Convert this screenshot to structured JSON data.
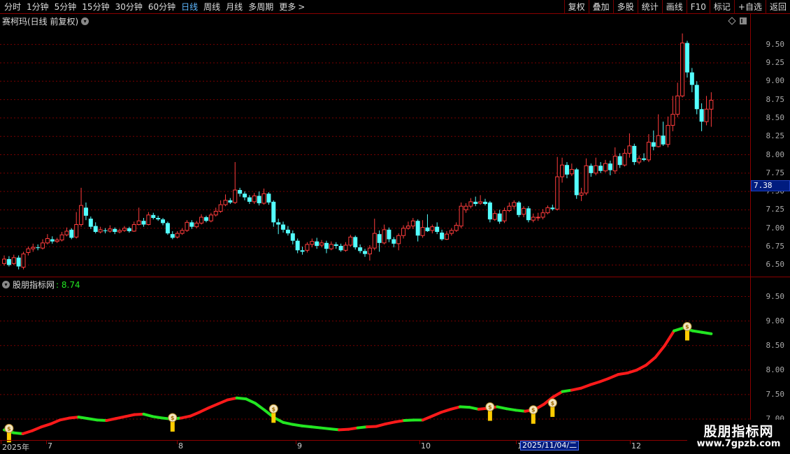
{
  "toolbar": {
    "periods": [
      "分时",
      "1分钟",
      "5分钟",
      "15分钟",
      "30分钟",
      "60分钟",
      "日线",
      "周线",
      "月线",
      "多周期",
      "更多"
    ],
    "active_period": "日线",
    "more_arrow": ">",
    "right_buttons": [
      "复权",
      "叠加",
      "多股",
      "统计",
      "画线",
      "F10",
      "标记",
      "+自选",
      "返回"
    ]
  },
  "main_panel": {
    "title": "赛柯玛(日线 前复权)",
    "dropdown_icon": "chevron-down-icon",
    "diamond_icon": "diamond-icon",
    "panel_icon": "panel-toggle-icon",
    "price_levels": [
      "9.50",
      "9.25",
      "9.00",
      "8.75",
      "8.50",
      "8.25",
      "8.00",
      "7.75",
      "7.50",
      "7.25",
      "7.00",
      "6.75",
      "6.50"
    ],
    "current_price": "7.38"
  },
  "indicator_panel": {
    "title": "股朋指标网",
    "value": ": 8.74",
    "price_levels": [
      "9.50",
      "9.00",
      "8.50",
      "8.00",
      "7.50",
      "7.00"
    ]
  },
  "date_axis": {
    "labels": [
      "2025年",
      "7",
      "8",
      "9",
      "10",
      "11",
      "12"
    ],
    "cursor_date": "2025/11/04/二"
  },
  "watermark": {
    "title": "股朋指标网",
    "url": "www.7gpzb.com"
  },
  "colors": {
    "up": "#ff3c3c",
    "down": "#54ffff",
    "line_up": "#ff1a1a",
    "line_down": "#22e622",
    "grid": "#7a0000",
    "axis": "#8b0000",
    "money_bag": "#ffcc00"
  },
  "chart_data": {
    "type": "candlestick",
    "candles": [
      [
        6.52,
        6.58,
        6.63,
        6.49
      ],
      [
        6.58,
        6.5,
        6.62,
        6.48
      ],
      [
        6.52,
        6.6,
        6.64,
        6.5
      ],
      [
        6.6,
        6.48,
        6.63,
        6.44
      ],
      [
        6.47,
        6.65,
        6.68,
        6.44
      ],
      [
        6.67,
        6.72,
        6.75,
        6.63
      ],
      [
        6.72,
        6.74,
        6.79,
        6.68
      ],
      [
        6.74,
        6.73,
        6.78,
        6.7
      ],
      [
        6.73,
        6.8,
        6.85,
        6.71
      ],
      [
        6.8,
        6.86,
        6.92,
        6.78
      ],
      [
        6.85,
        6.82,
        6.89,
        6.79
      ],
      [
        6.82,
        6.84,
        6.87,
        6.8
      ],
      [
        6.84,
        6.91,
        6.95,
        6.82
      ],
      [
        6.91,
        6.96,
        7.01,
        6.89
      ],
      [
        6.98,
        6.87,
        7.0,
        6.85
      ],
      [
        6.88,
        7.05,
        7.22,
        6.86
      ],
      [
        7.05,
        7.31,
        7.55,
        7.02
      ],
      [
        7.28,
        7.17,
        7.35,
        7.11
      ],
      [
        7.13,
        7.02,
        7.16,
        6.99
      ],
      [
        7.03,
        6.95,
        7.08,
        6.93
      ],
      [
        6.95,
        6.98,
        7.02,
        6.93
      ],
      [
        6.97,
        6.96,
        7.0,
        6.93
      ],
      [
        6.96,
        6.99,
        7.04,
        6.94
      ],
      [
        6.99,
        6.95,
        7.01,
        6.92
      ],
      [
        6.95,
        6.97,
        6.99,
        6.93
      ],
      [
        6.97,
        7.0,
        7.03,
        6.95
      ],
      [
        7.0,
        6.96,
        7.02,
        6.94
      ],
      [
        6.96,
        7.05,
        7.09,
        6.95
      ],
      [
        7.05,
        7.1,
        7.28,
        7.04
      ],
      [
        7.1,
        7.05,
        7.14,
        7.02
      ],
      [
        7.05,
        7.18,
        7.22,
        7.04
      ],
      [
        7.18,
        7.14,
        7.21,
        7.12
      ],
      [
        7.14,
        7.12,
        7.17,
        7.1
      ],
      [
        7.12,
        7.07,
        7.14,
        7.04
      ],
      [
        7.07,
        6.93,
        7.09,
        6.91
      ],
      [
        6.92,
        6.87,
        6.96,
        6.85
      ],
      [
        6.88,
        6.93,
        6.96,
        6.86
      ],
      [
        6.93,
        6.97,
        7.0,
        6.91
      ],
      [
        6.97,
        7.08,
        7.11,
        6.95
      ],
      [
        7.08,
        7.02,
        7.11,
        6.99
      ],
      [
        7.02,
        7.07,
        7.1,
        7.0
      ],
      [
        7.07,
        7.15,
        7.19,
        7.05
      ],
      [
        7.15,
        7.1,
        7.17,
        7.08
      ],
      [
        7.1,
        7.18,
        7.21,
        7.08
      ],
      [
        7.18,
        7.23,
        7.28,
        7.16
      ],
      [
        7.23,
        7.32,
        7.38,
        7.21
      ],
      [
        7.32,
        7.38,
        7.46,
        7.3
      ],
      [
        7.38,
        7.35,
        7.41,
        7.33
      ],
      [
        7.35,
        7.52,
        7.9,
        7.33
      ],
      [
        7.52,
        7.47,
        7.55,
        7.43
      ],
      [
        7.47,
        7.42,
        7.5,
        7.38
      ],
      [
        7.42,
        7.36,
        7.45,
        7.33
      ],
      [
        7.36,
        7.44,
        7.48,
        7.33
      ],
      [
        7.44,
        7.34,
        7.5,
        7.31
      ],
      [
        7.34,
        7.47,
        7.54,
        7.32
      ],
      [
        7.47,
        7.35,
        7.49,
        7.32
      ],
      [
        7.36,
        7.08,
        7.38,
        7.02
      ],
      [
        7.08,
        7.05,
        7.13,
        6.92
      ],
      [
        7.05,
        6.98,
        7.09,
        6.94
      ],
      [
        6.98,
        6.93,
        7.03,
        6.9
      ],
      [
        6.93,
        6.83,
        6.97,
        6.78
      ],
      [
        6.83,
        6.7,
        6.86,
        6.66
      ],
      [
        6.7,
        6.68,
        6.75,
        6.64
      ],
      [
        6.7,
        6.78,
        6.81,
        6.67
      ],
      [
        6.78,
        6.82,
        6.86,
        6.74
      ],
      [
        6.82,
        6.76,
        6.87,
        6.72
      ],
      [
        6.77,
        6.8,
        6.84,
        6.74
      ],
      [
        6.8,
        6.72,
        6.83,
        6.66
      ],
      [
        6.72,
        6.78,
        6.82,
        6.7
      ],
      [
        6.78,
        6.76,
        6.81,
        6.72
      ],
      [
        6.76,
        6.7,
        6.79,
        6.68
      ],
      [
        6.7,
        6.77,
        6.81,
        6.68
      ],
      [
        6.77,
        6.88,
        6.91,
        6.75
      ],
      [
        6.88,
        6.74,
        6.9,
        6.71
      ],
      [
        6.74,
        6.69,
        6.78,
        6.66
      ],
      [
        6.69,
        6.65,
        6.72,
        6.61
      ],
      [
        6.65,
        6.73,
        6.77,
        6.56
      ],
      [
        6.73,
        6.93,
        7.13,
        6.7
      ],
      [
        6.92,
        6.8,
        6.97,
        6.68
      ],
      [
        6.8,
        6.98,
        7.05,
        6.78
      ],
      [
        6.98,
        6.85,
        7.01,
        6.81
      ],
      [
        6.85,
        6.79,
        6.88,
        6.74
      ],
      [
        6.79,
        6.9,
        6.93,
        6.7
      ],
      [
        6.9,
        7.0,
        7.04,
        6.86
      ],
      [
        7.0,
        7.03,
        7.09,
        6.98
      ],
      [
        7.03,
        7.1,
        7.14,
        6.99
      ],
      [
        7.1,
        6.9,
        7.12,
        6.82
      ],
      [
        6.9,
        7.01,
        7.11,
        6.87
      ],
      [
        7.01,
        6.96,
        7.19,
        6.95
      ],
      [
        6.97,
        7.02,
        7.05,
        6.93
      ],
      [
        7.02,
        6.95,
        7.08,
        6.92
      ],
      [
        6.94,
        6.85,
        6.98,
        6.83
      ],
      [
        6.85,
        6.92,
        6.96,
        6.84
      ],
      [
        6.93,
        6.97,
        7.0,
        6.9
      ],
      [
        6.97,
        7.04,
        7.08,
        6.95
      ],
      [
        7.03,
        7.3,
        7.35,
        7.0
      ],
      [
        7.25,
        7.3,
        7.34,
        7.21
      ],
      [
        7.3,
        7.36,
        7.41,
        7.27
      ],
      [
        7.36,
        7.33,
        7.43,
        7.3
      ],
      [
        7.34,
        7.36,
        7.45,
        7.32
      ],
      [
        7.36,
        7.33,
        7.4,
        7.31
      ],
      [
        7.35,
        7.12,
        7.37,
        7.08
      ],
      [
        7.12,
        7.2,
        7.24,
        7.1
      ],
      [
        7.2,
        7.09,
        7.25,
        7.06
      ],
      [
        7.1,
        7.24,
        7.28,
        7.07
      ],
      [
        7.24,
        7.3,
        7.35,
        7.22
      ],
      [
        7.3,
        7.35,
        7.38,
        7.26
      ],
      [
        7.35,
        7.18,
        7.37,
        7.15
      ],
      [
        7.19,
        7.27,
        7.3,
        7.15
      ],
      [
        7.27,
        7.11,
        7.3,
        7.08
      ],
      [
        7.11,
        7.15,
        7.2,
        7.08
      ],
      [
        7.15,
        7.15,
        7.21,
        7.1
      ],
      [
        7.15,
        7.21,
        7.26,
        7.12
      ],
      [
        7.21,
        7.28,
        7.31,
        7.19
      ],
      [
        7.28,
        7.26,
        7.32,
        7.24
      ],
      [
        7.26,
        7.7,
        7.97,
        7.24
      ],
      [
        7.7,
        7.86,
        7.96,
        7.62
      ],
      [
        7.86,
        7.73,
        7.9,
        7.68
      ],
      [
        7.74,
        7.8,
        7.88,
        7.71
      ],
      [
        7.8,
        7.45,
        7.82,
        7.4
      ],
      [
        7.45,
        7.48,
        7.55,
        7.37
      ],
      [
        7.48,
        7.85,
        7.95,
        7.45
      ],
      [
        7.85,
        7.75,
        7.88,
        7.7
      ],
      [
        7.75,
        7.85,
        7.96,
        7.72
      ],
      [
        7.85,
        7.78,
        7.9,
        7.75
      ],
      [
        7.78,
        7.88,
        7.93,
        7.76
      ],
      [
        7.88,
        7.79,
        7.92,
        7.72
      ],
      [
        7.78,
        7.98,
        8.1,
        7.74
      ],
      [
        7.98,
        7.86,
        8.02,
        7.82
      ],
      [
        7.86,
        8.02,
        8.08,
        7.84
      ],
      [
        8.02,
        8.12,
        8.29,
        7.96
      ],
      [
        8.12,
        7.9,
        8.15,
        7.86
      ],
      [
        7.9,
        7.95,
        7.99,
        7.87
      ],
      [
        7.95,
        7.93,
        8.02,
        7.91
      ],
      [
        7.93,
        8.17,
        8.28,
        7.9
      ],
      [
        8.17,
        8.11,
        8.33,
        8.06
      ],
      [
        8.11,
        8.26,
        8.55,
        8.1
      ],
      [
        8.26,
        8.14,
        8.45,
        8.12
      ],
      [
        8.14,
        8.4,
        8.52,
        8.1
      ],
      [
        8.4,
        8.55,
        8.8,
        8.32
      ],
      [
        8.55,
        8.8,
        8.98,
        8.51
      ],
      [
        8.8,
        9.52,
        9.65,
        8.78
      ],
      [
        9.52,
        9.12,
        9.55,
        9.05
      ],
      [
        9.12,
        8.95,
        9.18,
        8.85
      ],
      [
        8.95,
        8.62,
        9.0,
        8.55
      ],
      [
        8.62,
        8.45,
        8.7,
        8.32
      ],
      [
        8.45,
        8.62,
        8.8,
        8.4
      ],
      [
        8.62,
        8.74,
        8.85,
        8.38
      ]
    ],
    "indicator_line": [
      [
        6.78,
        0
      ],
      [
        6.72,
        0
      ],
      [
        6.7,
        0
      ],
      [
        6.76,
        1
      ],
      [
        6.84,
        1
      ],
      [
        6.9,
        1
      ],
      [
        6.98,
        1
      ],
      [
        7.02,
        1
      ],
      [
        7.04,
        1
      ],
      [
        7.01,
        0
      ],
      [
        6.98,
        0
      ],
      [
        6.97,
        0
      ],
      [
        7.01,
        1
      ],
      [
        7.05,
        1
      ],
      [
        7.09,
        1
      ],
      [
        7.1,
        1
      ],
      [
        7.05,
        0
      ],
      [
        7.02,
        0
      ],
      [
        7.0,
        0
      ],
      [
        7.02,
        0
      ],
      [
        7.06,
        1
      ],
      [
        7.14,
        1
      ],
      [
        7.23,
        1
      ],
      [
        7.31,
        1
      ],
      [
        7.39,
        1
      ],
      [
        7.43,
        1
      ],
      [
        7.41,
        0
      ],
      [
        7.32,
        0
      ],
      [
        7.18,
        0
      ],
      [
        7.03,
        0
      ],
      [
        6.93,
        0
      ],
      [
        6.89,
        0
      ],
      [
        6.86,
        0
      ],
      [
        6.84,
        0
      ],
      [
        6.82,
        0
      ],
      [
        6.8,
        0
      ],
      [
        6.78,
        0
      ],
      [
        6.79,
        1
      ],
      [
        6.82,
        1
      ],
      [
        6.84,
        0
      ],
      [
        6.85,
        1
      ],
      [
        6.9,
        1
      ],
      [
        6.94,
        1
      ],
      [
        6.97,
        1
      ],
      [
        6.98,
        0
      ],
      [
        6.98,
        0
      ],
      [
        7.06,
        1
      ],
      [
        7.14,
        1
      ],
      [
        7.2,
        1
      ],
      [
        7.25,
        1
      ],
      [
        7.24,
        0
      ],
      [
        7.2,
        0
      ],
      [
        7.22,
        1
      ],
      [
        7.25,
        1
      ],
      [
        7.21,
        0
      ],
      [
        7.18,
        0
      ],
      [
        7.16,
        0
      ],
      [
        7.19,
        1
      ],
      [
        7.3,
        1
      ],
      [
        7.45,
        1
      ],
      [
        7.56,
        1
      ],
      [
        7.59,
        0
      ],
      [
        7.63,
        1
      ],
      [
        7.7,
        1
      ],
      [
        7.76,
        1
      ],
      [
        7.83,
        1
      ],
      [
        7.91,
        1
      ],
      [
        7.94,
        1
      ],
      [
        8.0,
        1
      ],
      [
        8.1,
        1
      ],
      [
        8.26,
        1
      ],
      [
        8.5,
        1
      ],
      [
        8.8,
        1
      ],
      [
        8.86,
        0
      ],
      [
        8.8,
        0
      ],
      [
        8.77,
        0
      ],
      [
        8.74,
        0
      ]
    ],
    "signals": [
      1,
      35,
      56,
      101,
      110,
      114,
      142
    ],
    "ylim_main": [
      6.38,
      9.82
    ],
    "ylim_indicator": [
      6.6,
      9.85
    ]
  }
}
